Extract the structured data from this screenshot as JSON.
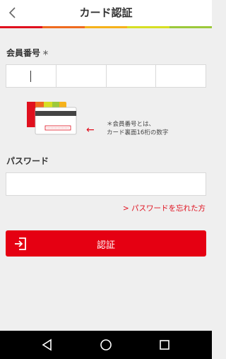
{
  "header": {
    "title": "カード認証"
  },
  "stripe_colors": [
    "#e0101e",
    "#ef6b1f",
    "#f6b21b",
    "#d7df23",
    "#9cc93b"
  ],
  "member": {
    "label": "会員番号",
    "required_mark": "＊",
    "segments": [
      "",
      "",
      "",
      ""
    ]
  },
  "hint": {
    "line1": "＊会員番号とは、",
    "line2": "カード裏面16桁の数字"
  },
  "password": {
    "label": "パスワード",
    "value": "",
    "forgot_link": "> パスワードを忘れた方"
  },
  "auth_button": {
    "label": "認証"
  },
  "icons": {
    "back": "chevron-left-icon",
    "auth": "login-icon",
    "arrow": "arrow-left-icon",
    "nav_back": "triangle-back-icon",
    "nav_home": "circle-home-icon",
    "nav_recent": "square-recent-icon"
  },
  "colors": {
    "accent": "#e50012",
    "background": "#efefef"
  }
}
